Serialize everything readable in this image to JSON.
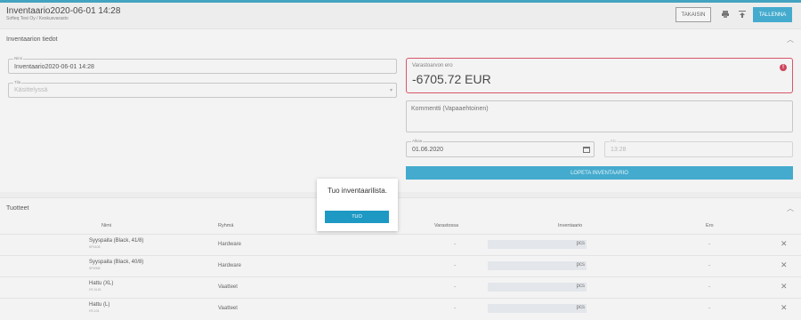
{
  "header": {
    "title": "Inventaario2020-06-01 14:28",
    "subtitle": "Softeq Test Oy / Keskusvarasto",
    "back_label": "TAKAISIN",
    "print_icon": "printer-icon",
    "upload_icon": "upload-icon",
    "save_label": "TALLENNA"
  },
  "details": {
    "section_title": "Inventaarion tiedot",
    "collapse_icon": "chevron-up-icon",
    "name_label": "Nimi",
    "name_value": "Inventaario2020-06-01 14:28",
    "status_label": "Tila",
    "status_placeholder": "Käsittelyssä",
    "diff_label": "Varastoarvon ero",
    "diff_value": "-6705.72 EUR",
    "warning_icon": "alert-circle-icon",
    "comment_placeholder": "Kommentti (Vapaaehtoinen)",
    "start_label": "Alkaa",
    "start_value": "01.06.2020",
    "time_label": "Klo",
    "time_value": "13:28",
    "finish_button": "LOPETA INVENTAARIO"
  },
  "products": {
    "section_title": "Tuotteet",
    "columns": [
      "Nimi",
      "Ryhmä",
      "Varastossa",
      "Inventaario",
      "Ero"
    ],
    "rows": [
      {
        "name": "Syyspaita (Black, 41/8)",
        "code": "SP4108",
        "group": "Hardware",
        "stock": "-",
        "unit": "pcs",
        "diff": "-"
      },
      {
        "name": "Syyspaita (Black, 40/8)",
        "code": "SP4008",
        "group": "Hardware",
        "stock": "-",
        "unit": "pcs",
        "diff": "-"
      },
      {
        "name": "Hattu (XL)",
        "code": "HT-XL01",
        "group": "Vaatteet",
        "stock": "-",
        "unit": "pcs",
        "diff": "-"
      },
      {
        "name": "Hattu (L)",
        "code": "HT-L01",
        "group": "Vaatteet",
        "stock": "-",
        "unit": "pcs",
        "diff": "-"
      }
    ]
  },
  "dialog": {
    "message": "Tuo inventaarilista.",
    "button": "TUO"
  },
  "colors": {
    "accent": "#1d99c4",
    "error": "#c21d3b"
  }
}
